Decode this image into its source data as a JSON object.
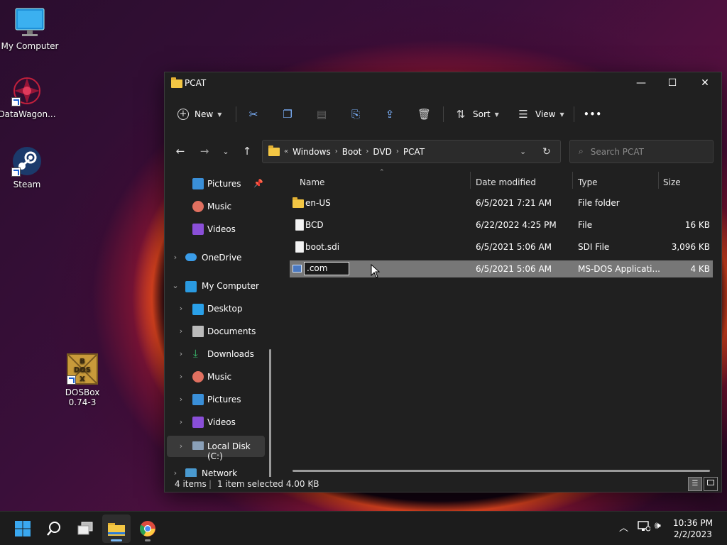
{
  "desktop": {
    "icons": [
      {
        "label": "My Computer"
      },
      {
        "label": "DataWagon..."
      },
      {
        "label": "Steam"
      },
      {
        "label_line1": "DOSBox",
        "label_line2": "0.74-3",
        "dos_glyph": "DOS",
        "b": "B",
        "x": "X"
      }
    ]
  },
  "window": {
    "title": "PCAT",
    "controls": {
      "minimize": "—",
      "maximize": "☐",
      "close": "✕"
    },
    "toolbar": {
      "new_label": "New",
      "sort_label": "Sort",
      "view_label": "View",
      "more": "•••"
    },
    "address": {
      "overflow": "«",
      "crumbs": [
        "Windows",
        "Boot",
        "DVD",
        "PCAT"
      ]
    },
    "search": {
      "placeholder": "Search PCAT"
    },
    "nav": {
      "items": [
        {
          "label": "Pictures"
        },
        {
          "label": "Music"
        },
        {
          "label": "Videos"
        },
        {
          "label": "OneDrive"
        },
        {
          "label": "My Computer"
        },
        {
          "label": "Desktop"
        },
        {
          "label": "Documents"
        },
        {
          "label": "Downloads"
        },
        {
          "label": "Music"
        },
        {
          "label": "Pictures"
        },
        {
          "label": "Videos"
        },
        {
          "label": "Local Disk (C:)"
        },
        {
          "label": "Network"
        }
      ]
    },
    "columns": {
      "name": "Name",
      "date": "Date modified",
      "type": "Type",
      "size": "Size"
    },
    "files": [
      {
        "name": "en-US",
        "date": "6/5/2021 7:21 AM",
        "type": "File folder",
        "size": ""
      },
      {
        "name": "BCD",
        "date": "6/22/2022 4:25 PM",
        "type": "File",
        "size": "16 KB"
      },
      {
        "name": "boot.sdi",
        "date": "6/5/2021 5:06 AM",
        "type": "SDI File",
        "size": "3,096 KB"
      },
      {
        "name": ".com",
        "date": "6/5/2021 5:06 AM",
        "type": "MS-DOS Applicati...",
        "size": "4 KB"
      }
    ],
    "status": {
      "items": "4 items",
      "selected": "1 item selected  4.00 KB",
      "sep": "|"
    }
  },
  "taskbar": {
    "time": "10:36 PM",
    "date": "2/2/2023",
    "accent": "#79b8f4"
  }
}
